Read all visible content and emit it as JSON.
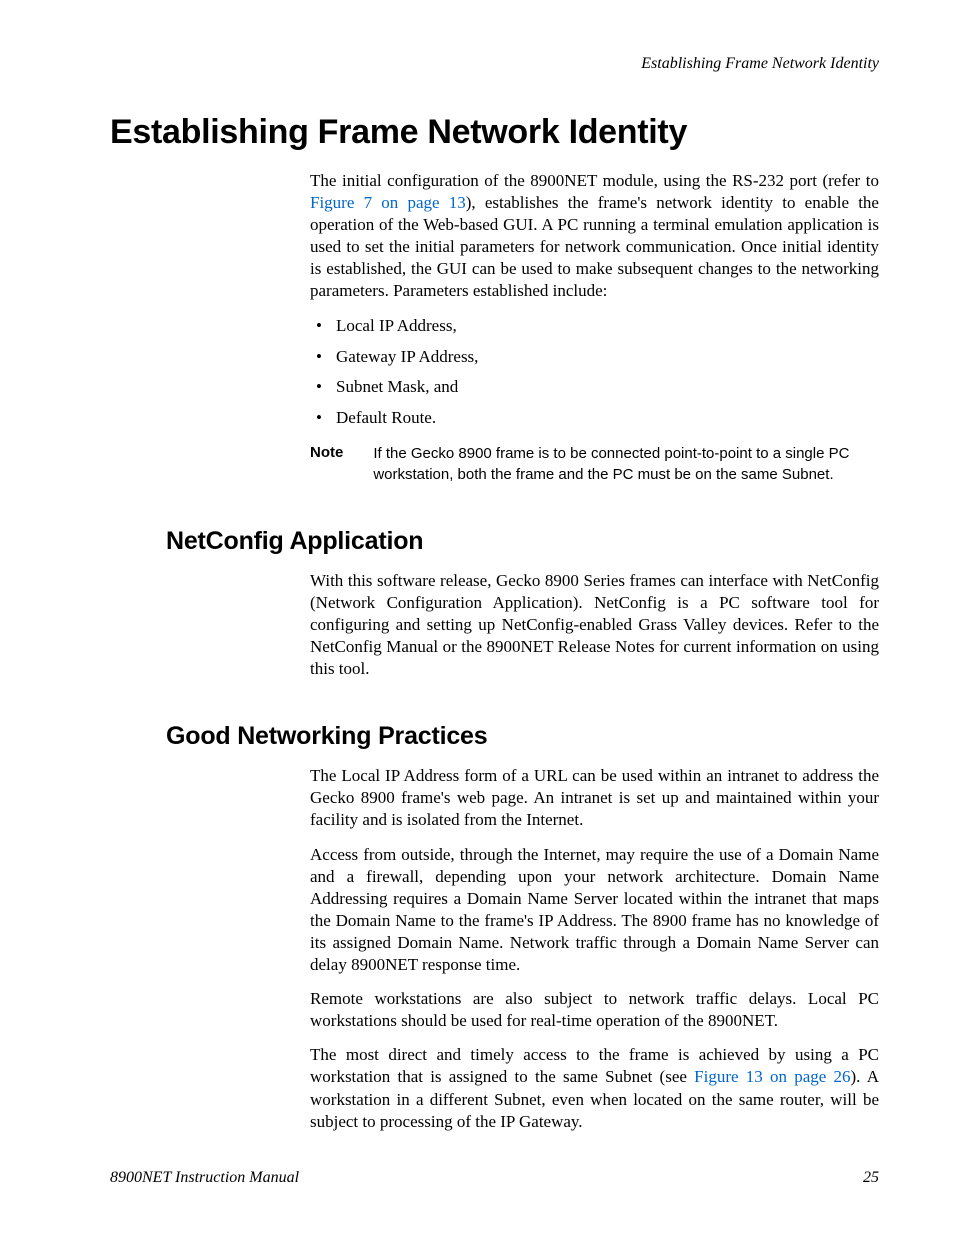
{
  "running_header": "Establishing Frame Network Identity",
  "page_title": "Establishing Frame Network Identity",
  "intro_p1_a": "The initial configuration of the 8900NET module, using the RS-232 port (refer to ",
  "intro_link1": "Figure 7 on page 13",
  "intro_p1_b": "), establishes the frame's network identity to enable the operation of the Web-based GUI. A PC running a terminal emulation application is used to set the initial parameters for network communication. Once initial identity is established, the GUI can be used to make subsequent changes to the networking parameters. Parameters established include:",
  "bullets": {
    "b1": "Local IP Address,",
    "b2": "Gateway IP Address,",
    "b3": "Subnet Mask, and",
    "b4": "Default Route."
  },
  "note_label": "Note",
  "note_text": "If the Gecko 8900 frame is to be connected point-to-point to a single PC workstation, both the frame and the PC must be on the same Subnet.",
  "section1_heading": "NetConfig Application",
  "section1_p1": "With this software release, Gecko 8900 Series frames can interface with NetConfig (Network Configuration Application). NetConfig is a PC software tool for configuring and setting up NetConfig-enabled Grass Valley devices. Refer to the NetConfig Manual or the 8900NET Release Notes for current information on using this tool.",
  "section2_heading": "Good Networking Practices",
  "section2_p1": "The Local IP Address form of a URL can be used within an intranet to address the Gecko 8900 frame's web page. An intranet is set up and maintained within your facility and is isolated from the Internet.",
  "section2_p2": "Access from outside, through the Internet, may require the use of a Domain Name and a firewall, depending upon your network architecture. Domain Name Addressing requires a Domain Name Server located within the intranet that maps the Domain Name to the frame's IP Address. The 8900 frame has no knowledge of its assigned Domain Name. Network traffic through a Domain Name Server can delay 8900NET response time.",
  "section2_p3": "Remote workstations are also subject to network traffic delays. Local PC workstations should be used for real-time operation of the 8900NET.",
  "section2_p4_a": "The most direct and timely access to the frame is achieved by using a PC workstation that is assigned to the same Subnet (see ",
  "section2_link1": "Figure 13 on page 26",
  "section2_p4_b": "). A workstation in a different Subnet, even when located on the same router, will be subject to processing of the IP Gateway.",
  "footer_left": "8900NET  Instruction Manual",
  "footer_right": "25"
}
